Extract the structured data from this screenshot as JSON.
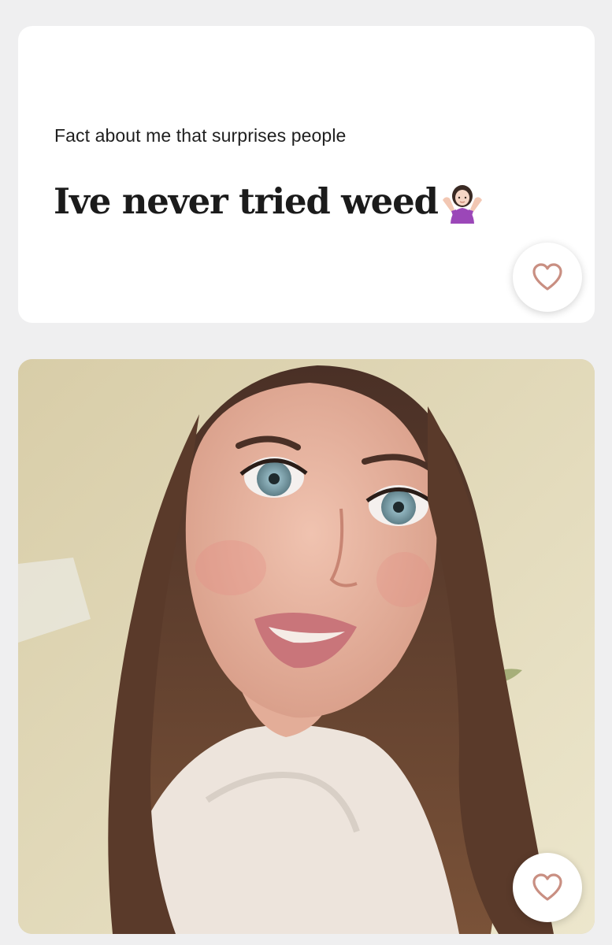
{
  "prompt": {
    "question": "Fact about me that surprises people",
    "answer": "Ive never tried weed",
    "emoji": "woman-shrugging-emoji",
    "like_icon": "heart-icon"
  },
  "photo": {
    "like_icon": "heart-icon"
  },
  "colors": {
    "background": "#efeff0",
    "card": "#ffffff",
    "text": "#1b1b1b",
    "heart_stroke": "#c98f82"
  }
}
